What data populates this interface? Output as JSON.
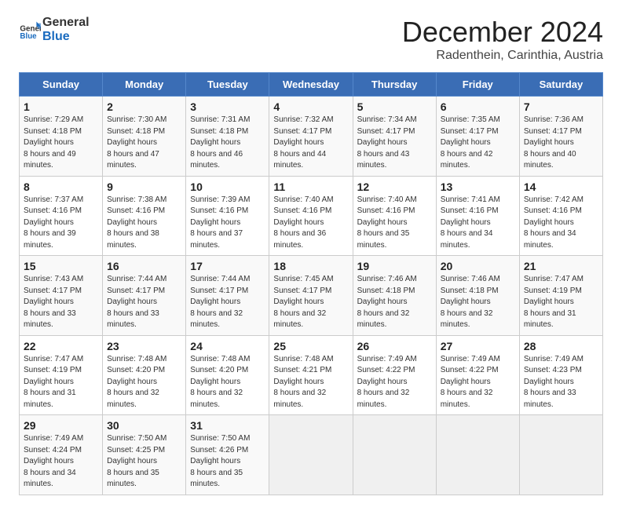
{
  "header": {
    "logo_general": "General",
    "logo_blue": "Blue",
    "month": "December 2024",
    "location": "Radenthein, Carinthia, Austria"
  },
  "days_of_week": [
    "Sunday",
    "Monday",
    "Tuesday",
    "Wednesday",
    "Thursday",
    "Friday",
    "Saturday"
  ],
  "weeks": [
    [
      {
        "day": "1",
        "sunrise": "7:29 AM",
        "sunset": "4:18 PM",
        "daylight": "8 hours and 49 minutes."
      },
      {
        "day": "2",
        "sunrise": "7:30 AM",
        "sunset": "4:18 PM",
        "daylight": "8 hours and 47 minutes."
      },
      {
        "day": "3",
        "sunrise": "7:31 AM",
        "sunset": "4:18 PM",
        "daylight": "8 hours and 46 minutes."
      },
      {
        "day": "4",
        "sunrise": "7:32 AM",
        "sunset": "4:17 PM",
        "daylight": "8 hours and 44 minutes."
      },
      {
        "day": "5",
        "sunrise": "7:34 AM",
        "sunset": "4:17 PM",
        "daylight": "8 hours and 43 minutes."
      },
      {
        "day": "6",
        "sunrise": "7:35 AM",
        "sunset": "4:17 PM",
        "daylight": "8 hours and 42 minutes."
      },
      {
        "day": "7",
        "sunrise": "7:36 AM",
        "sunset": "4:17 PM",
        "daylight": "8 hours and 40 minutes."
      }
    ],
    [
      {
        "day": "8",
        "sunrise": "7:37 AM",
        "sunset": "4:16 PM",
        "daylight": "8 hours and 39 minutes."
      },
      {
        "day": "9",
        "sunrise": "7:38 AM",
        "sunset": "4:16 PM",
        "daylight": "8 hours and 38 minutes."
      },
      {
        "day": "10",
        "sunrise": "7:39 AM",
        "sunset": "4:16 PM",
        "daylight": "8 hours and 37 minutes."
      },
      {
        "day": "11",
        "sunrise": "7:40 AM",
        "sunset": "4:16 PM",
        "daylight": "8 hours and 36 minutes."
      },
      {
        "day": "12",
        "sunrise": "7:40 AM",
        "sunset": "4:16 PM",
        "daylight": "8 hours and 35 minutes."
      },
      {
        "day": "13",
        "sunrise": "7:41 AM",
        "sunset": "4:16 PM",
        "daylight": "8 hours and 34 minutes."
      },
      {
        "day": "14",
        "sunrise": "7:42 AM",
        "sunset": "4:16 PM",
        "daylight": "8 hours and 34 minutes."
      }
    ],
    [
      {
        "day": "15",
        "sunrise": "7:43 AM",
        "sunset": "4:17 PM",
        "daylight": "8 hours and 33 minutes."
      },
      {
        "day": "16",
        "sunrise": "7:44 AM",
        "sunset": "4:17 PM",
        "daylight": "8 hours and 33 minutes."
      },
      {
        "day": "17",
        "sunrise": "7:44 AM",
        "sunset": "4:17 PM",
        "daylight": "8 hours and 32 minutes."
      },
      {
        "day": "18",
        "sunrise": "7:45 AM",
        "sunset": "4:17 PM",
        "daylight": "8 hours and 32 minutes."
      },
      {
        "day": "19",
        "sunrise": "7:46 AM",
        "sunset": "4:18 PM",
        "daylight": "8 hours and 32 minutes."
      },
      {
        "day": "20",
        "sunrise": "7:46 AM",
        "sunset": "4:18 PM",
        "daylight": "8 hours and 32 minutes."
      },
      {
        "day": "21",
        "sunrise": "7:47 AM",
        "sunset": "4:19 PM",
        "daylight": "8 hours and 31 minutes."
      }
    ],
    [
      {
        "day": "22",
        "sunrise": "7:47 AM",
        "sunset": "4:19 PM",
        "daylight": "8 hours and 31 minutes."
      },
      {
        "day": "23",
        "sunrise": "7:48 AM",
        "sunset": "4:20 PM",
        "daylight": "8 hours and 32 minutes."
      },
      {
        "day": "24",
        "sunrise": "7:48 AM",
        "sunset": "4:20 PM",
        "daylight": "8 hours and 32 minutes."
      },
      {
        "day": "25",
        "sunrise": "7:48 AM",
        "sunset": "4:21 PM",
        "daylight": "8 hours and 32 minutes."
      },
      {
        "day": "26",
        "sunrise": "7:49 AM",
        "sunset": "4:22 PM",
        "daylight": "8 hours and 32 minutes."
      },
      {
        "day": "27",
        "sunrise": "7:49 AM",
        "sunset": "4:22 PM",
        "daylight": "8 hours and 32 minutes."
      },
      {
        "day": "28",
        "sunrise": "7:49 AM",
        "sunset": "4:23 PM",
        "daylight": "8 hours and 33 minutes."
      }
    ],
    [
      {
        "day": "29",
        "sunrise": "7:49 AM",
        "sunset": "4:24 PM",
        "daylight": "8 hours and 34 minutes."
      },
      {
        "day": "30",
        "sunrise": "7:50 AM",
        "sunset": "4:25 PM",
        "daylight": "8 hours and 35 minutes."
      },
      {
        "day": "31",
        "sunrise": "7:50 AM",
        "sunset": "4:26 PM",
        "daylight": "8 hours and 35 minutes."
      },
      {
        "day": "",
        "sunrise": "",
        "sunset": "",
        "daylight": ""
      },
      {
        "day": "",
        "sunrise": "",
        "sunset": "",
        "daylight": ""
      },
      {
        "day": "",
        "sunrise": "",
        "sunset": "",
        "daylight": ""
      },
      {
        "day": "",
        "sunrise": "",
        "sunset": "",
        "daylight": ""
      }
    ]
  ],
  "labels": {
    "sunrise": "Sunrise:",
    "sunset": "Sunset:",
    "daylight": "Daylight hours"
  }
}
